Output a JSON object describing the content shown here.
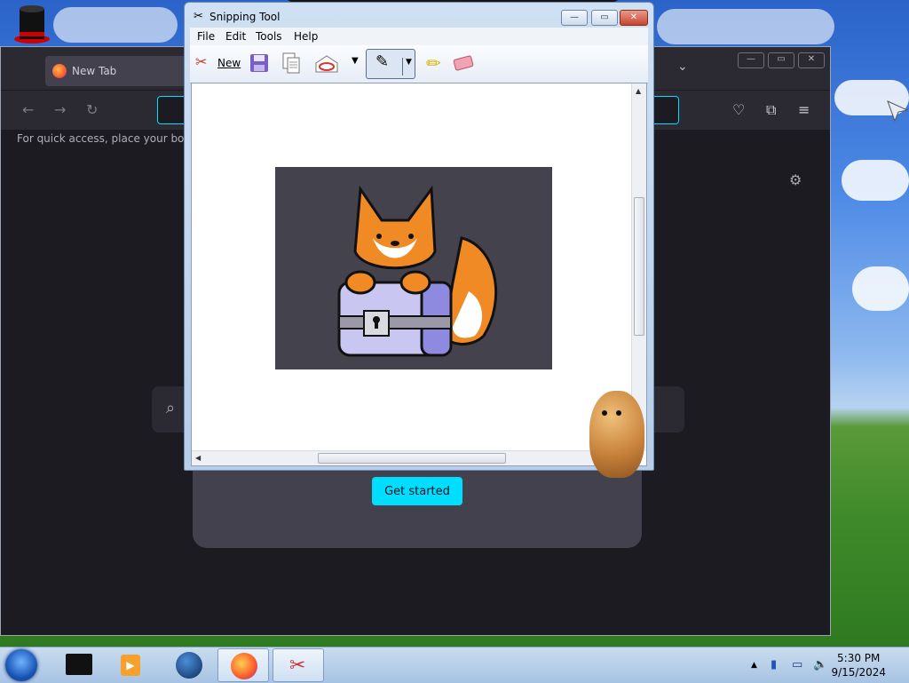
{
  "snipping_tool": {
    "title": "Snipping Tool",
    "menu": [
      "File",
      "Edit",
      "Tools",
      "Help"
    ],
    "new_label": "New"
  },
  "browser": {
    "tab_title": "New Tab",
    "bookmarks_hint": "For quick access, place your bookm",
    "get_started_label": "Get started"
  },
  "taskbar": {
    "time": "5:30 PM",
    "date": "9/15/2024"
  },
  "colors": {
    "accent_cyan": "#00ddff",
    "browser_bg": "#1c1b22"
  }
}
